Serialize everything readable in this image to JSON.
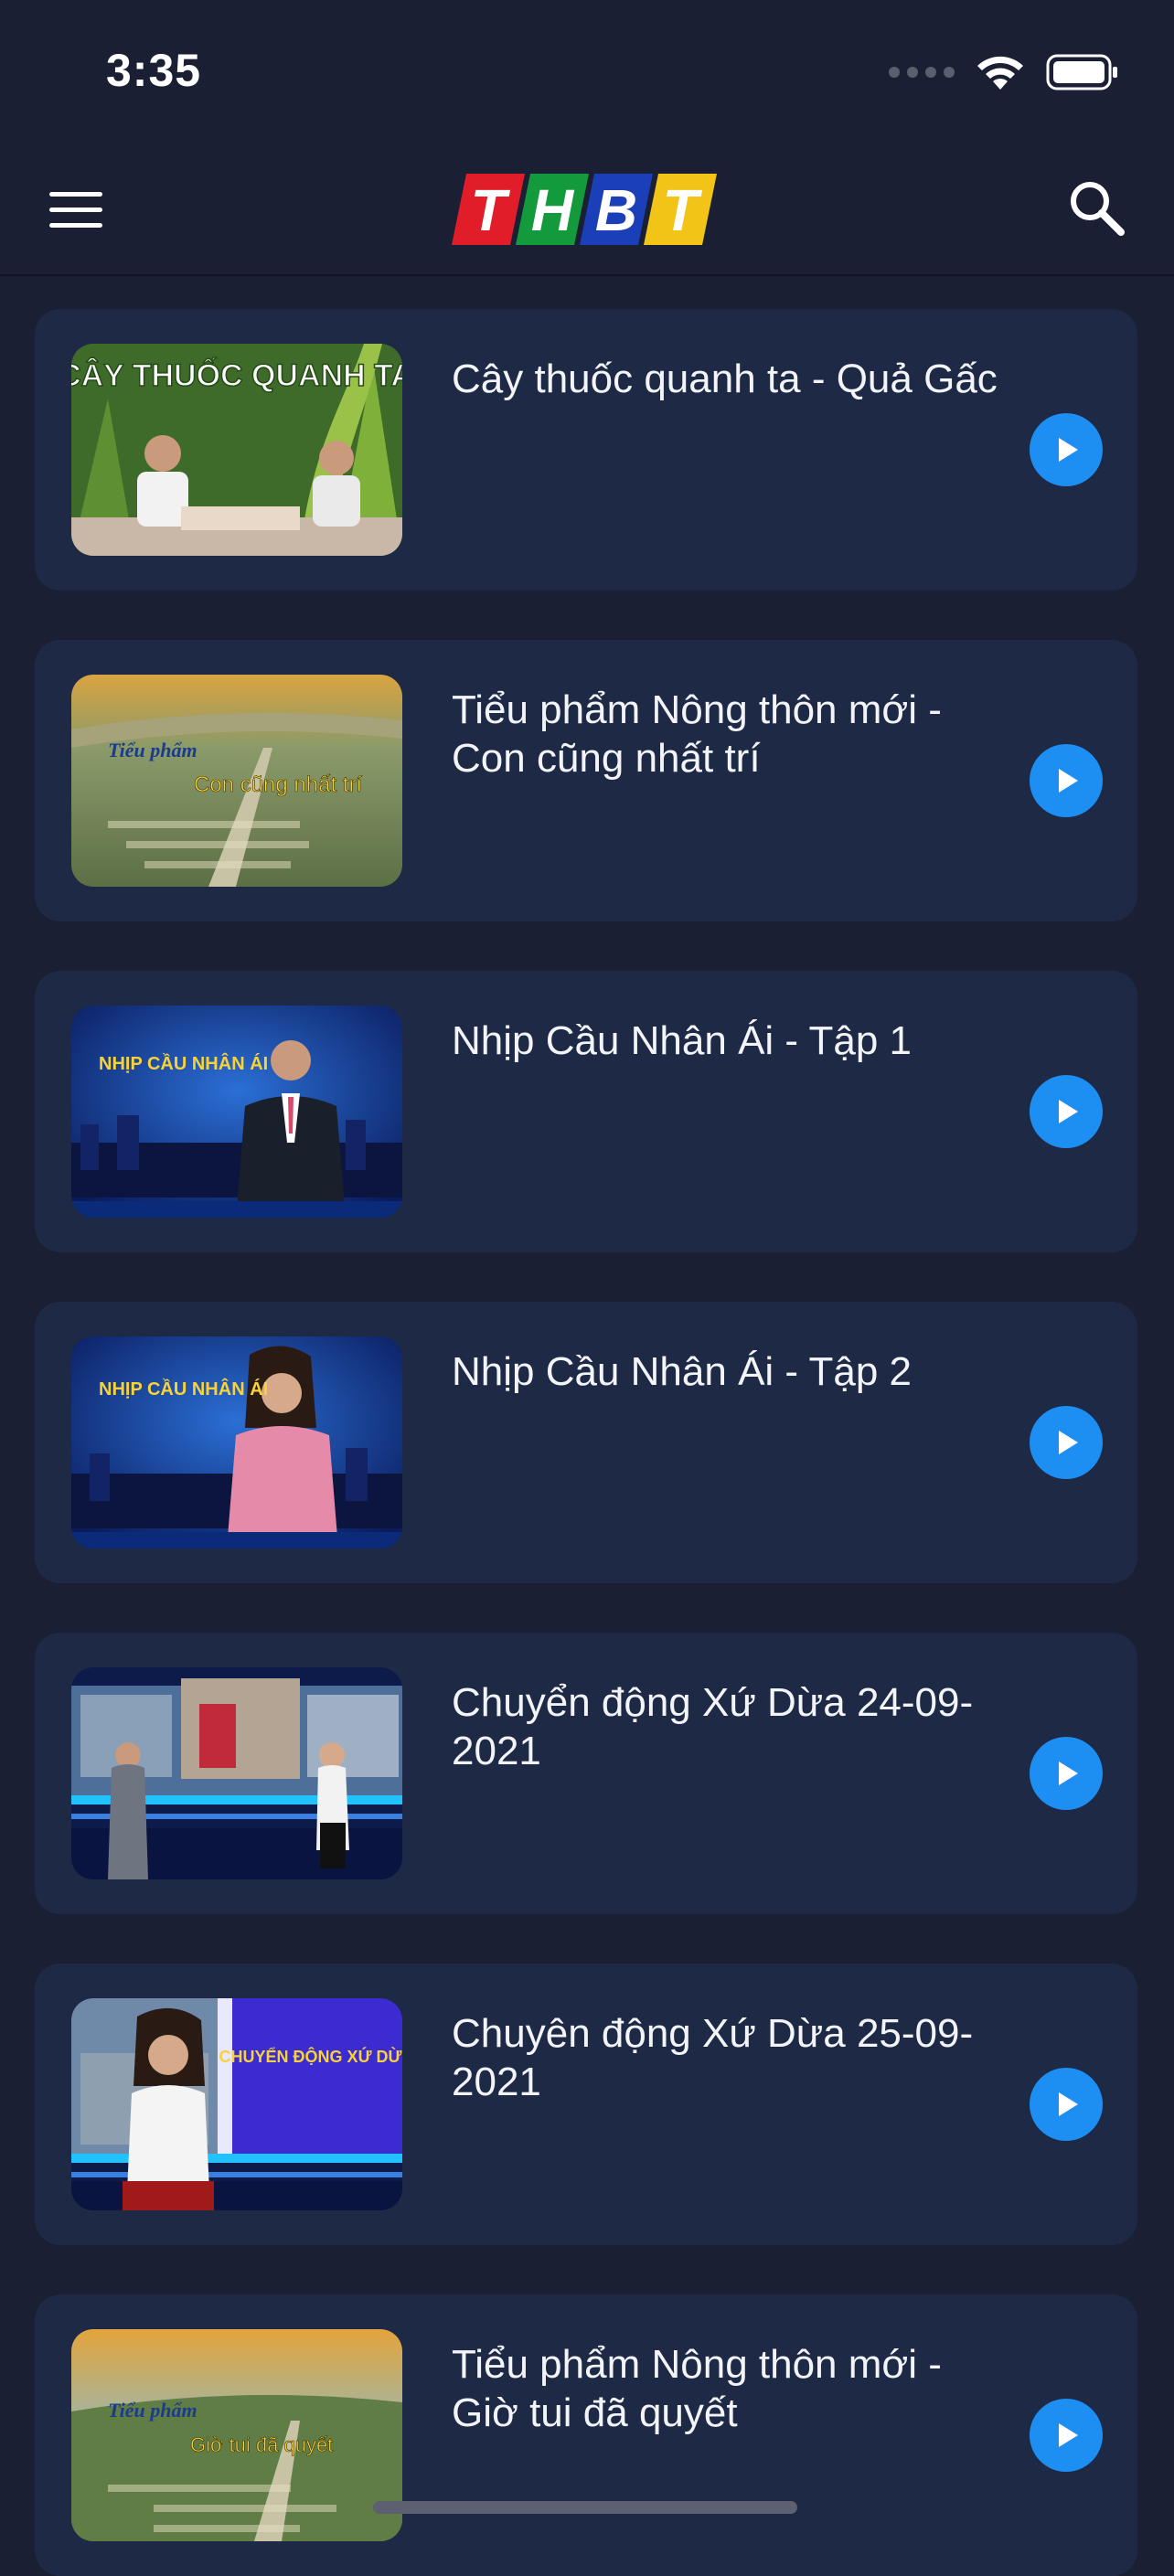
{
  "status_bar": {
    "time": "3:35"
  },
  "header": {
    "logo_text": "THBT",
    "menu_icon": "hamburger-menu-icon",
    "search_icon": "search-icon"
  },
  "theme": {
    "background": "#1a1f33",
    "card": "#1e2946",
    "accent": "#1d8ff2"
  },
  "videos": [
    {
      "title": "Cây thuốc quanh ta - Quả Gấc",
      "thumb_text": "CÂY THUỐC QUANH TA"
    },
    {
      "title": "Tiểu phẩm Nông thôn mới - Con cũng nhất trí",
      "thumb_text": "Con cũng nhất trí"
    },
    {
      "title": "Nhịp Cầu Nhân Ái - Tập 1",
      "thumb_text": "NHỊP CẦU NHÂN ÁI"
    },
    {
      "title": "Nhịp Cầu Nhân Ái - Tập 2",
      "thumb_text": "NHỊP CẦU NHÂN ÁI"
    },
    {
      "title": "Chuyển động Xứ Dừa 24-09-2021",
      "thumb_text": ""
    },
    {
      "title": "Chuyên động Xứ Dừa 25-09-2021",
      "thumb_text": "CHUYỂN ĐỘNG XỨ DỪA"
    },
    {
      "title": "Tiểu phẩm Nông thôn mới - Giờ tui đã quyết",
      "thumb_text": "Giờ tui đã quyết"
    }
  ]
}
